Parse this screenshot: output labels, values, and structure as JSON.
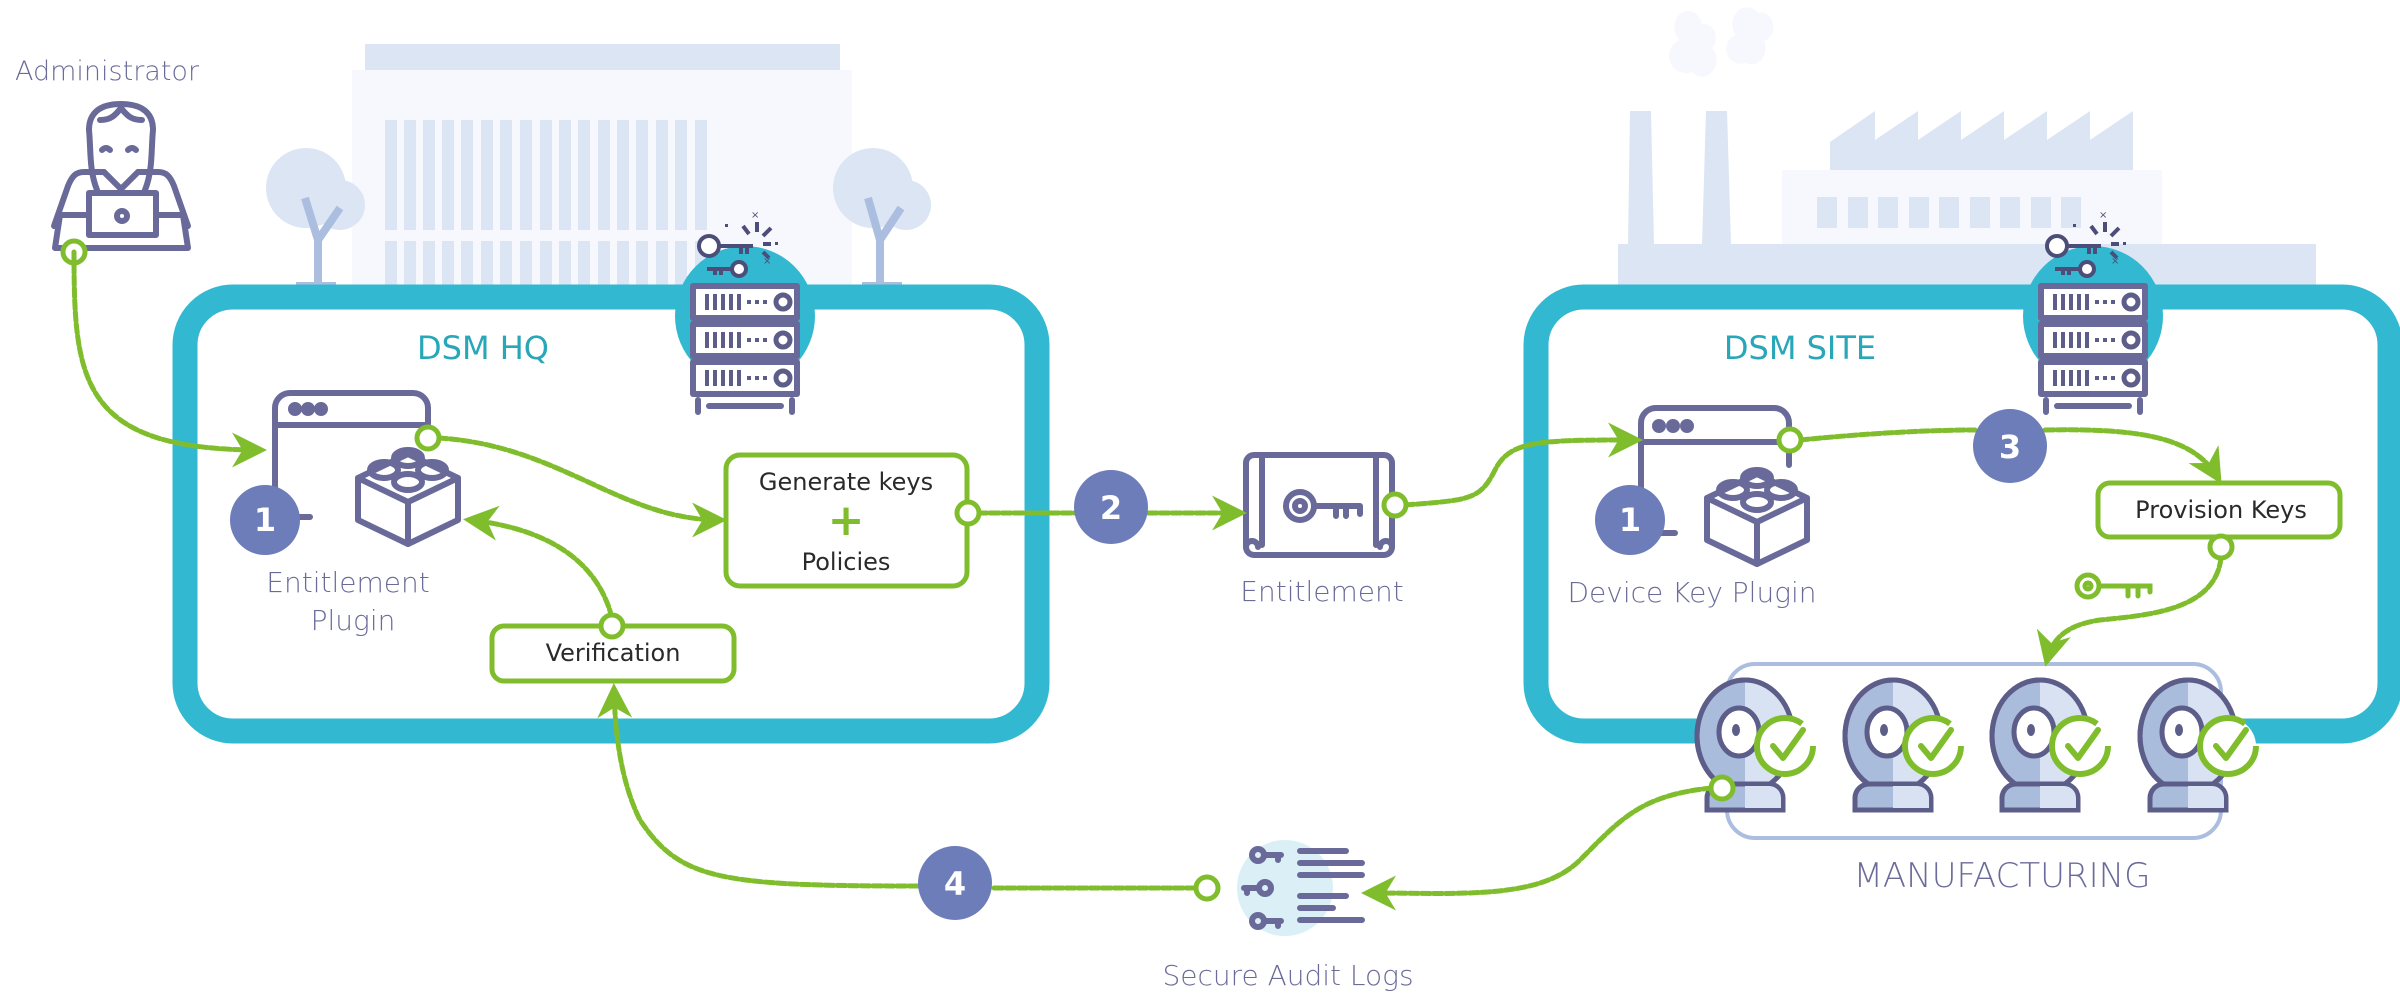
{
  "colors": {
    "teal_frame": "#33b8d1",
    "flow_green": "#80bd2d",
    "step_circle": "#6d7dba",
    "icon_stroke": "#6a6a9a",
    "title_teal": "#27a7b8",
    "background_shape": "#dce5f3"
  },
  "administrator": {
    "label": "Administrator",
    "icon": "person-with-laptop-icon"
  },
  "hq": {
    "title": "DSM HQ",
    "server_icon": "key-server-icon",
    "plugin": {
      "step": "1",
      "label_line1": "Entitlement",
      "label_line2": "Plugin",
      "icon": "plugin-block-icon"
    },
    "generate_box": {
      "line1": "Generate keys",
      "plus": "+",
      "line2": "Policies"
    },
    "verification_box": {
      "label": "Verification"
    }
  },
  "transfer": {
    "step": "2",
    "entitlement_label": "Entitlement",
    "icon": "key-scroll-icon"
  },
  "site": {
    "title": "DSM SITE",
    "server_icon": "key-server-icon",
    "plugin": {
      "step": "1",
      "label": "Device Key Plugin",
      "icon": "plugin-block-icon"
    },
    "provision_step": "3",
    "provision_box": {
      "label": "Provision Keys"
    },
    "key_icon": "key-icon"
  },
  "manufacturing": {
    "label": "MANUFACTURING",
    "devices": [
      {
        "name": "device-1",
        "status": "verified"
      },
      {
        "name": "device-2",
        "status": "verified"
      },
      {
        "name": "device-3",
        "status": "verified"
      },
      {
        "name": "device-4",
        "status": "verified"
      }
    ]
  },
  "audit": {
    "step": "4",
    "label": "Secure Audit Logs",
    "icon": "audit-log-icon"
  }
}
